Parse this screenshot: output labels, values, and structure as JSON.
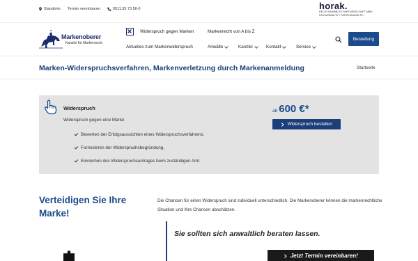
{
  "topbar": {
    "locations": "Standorte",
    "appointment": "Termin vereinbaren",
    "phone": "0511.35 73 56-0",
    "firm": {
      "logo": "horak.",
      "line1": "RECHTSANWÄLTE PARTNERSCHAFT MBB /",
      "line2": "FACHANWÄLTE / PATENTANWÄLTE /"
    }
  },
  "brand": {
    "name": "Markenoberer",
    "subtitle": "Kanzlei für Markenrecht"
  },
  "nav": {
    "row1": [
      "Widerspruch gegen Marken",
      "Markenrecht von A bis Z"
    ],
    "row2": [
      "Aktuelles zum Markenwiderspruch",
      "Anwälte",
      "Kanzlei",
      "Kontakt",
      "Service"
    ],
    "order_button": "Bestellung"
  },
  "page": {
    "title": "Marken-Widerspruchsverfahren, Markenverletzung durch Markenanmeldung",
    "breadcrumb": "Startseite"
  },
  "offer": {
    "title": "Widerspruch",
    "description": "Widerspruch gegen eine Marke",
    "features": [
      "Bewerten der Erfolgsaussichten eines Widerspruchsverfahrens.",
      "Formulieren der Widerspruchsbegründung.",
      "Einreichen des Widerspruchsantrages beim zuständigen Amt."
    ],
    "price_prefix": "ab",
    "price": "600 €*",
    "button": "Widerspruch bestellen"
  },
  "section": {
    "heading": "Verteidigen Sie Ihre Marke!",
    "paragraph": "Die Chancen für einen Widerspruch sind individuell unterschiedlich. Die Markenoberer können die markenrechtliche Situation und Ihre Chancen abschätzen.",
    "quote": "Sie sollten sich anwaltlich beraten lassen.",
    "cta": "Jetzt Termin vereinbaren!"
  },
  "colors": {
    "brand_blue": "#1c3f7a",
    "button_blue": "#1c4a8c",
    "panel_gray": "#e3e3e3"
  }
}
